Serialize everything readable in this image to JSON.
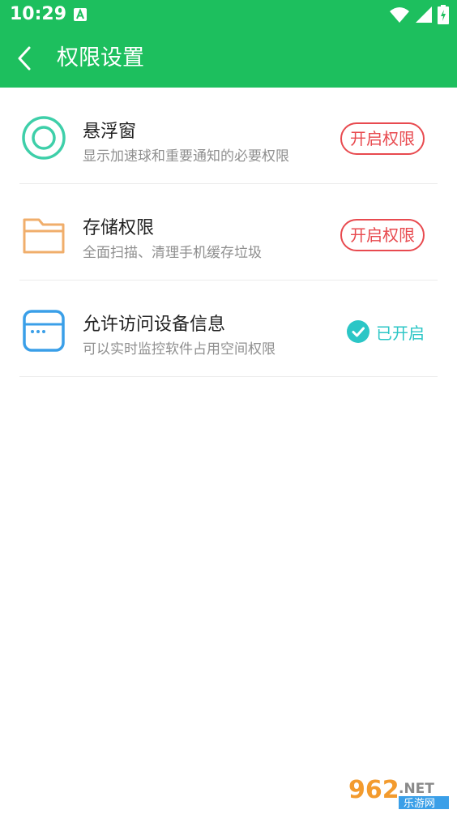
{
  "status_bar": {
    "time": "10:29",
    "icons": [
      "notification-a-icon",
      "wifi-icon",
      "signal-icon",
      "battery-charging-icon"
    ]
  },
  "header": {
    "title": "权限设置",
    "back_icon": "chevron-left-icon",
    "background_color": "#1DBF5E"
  },
  "permissions": [
    {
      "name": "悬浮窗",
      "description": "显示加速球和重要通知的必要权限",
      "action": "开启权限",
      "enabled": false,
      "icon": "floating-window-icon",
      "icon_color": "#3ECFA9"
    },
    {
      "name": "存储权限",
      "description": "全面扫描、清理手机缓存垃圾",
      "action": "开启权限",
      "enabled": false,
      "icon": "folder-icon",
      "icon_color": "#F0AE6B"
    },
    {
      "name": "允许访问设备信息",
      "description": "可以实时监控软件占用空间权限",
      "status": "已开启",
      "enabled": true,
      "icon": "device-window-icon",
      "icon_color": "#3A9FE8"
    }
  ],
  "colors": {
    "action_red": "#E84A4F",
    "enabled_teal": "#2BC6C6"
  },
  "watermark": {
    "brand_number": "962",
    "brand_suffix": ".NET",
    "brand_cn": "乐游网"
  }
}
